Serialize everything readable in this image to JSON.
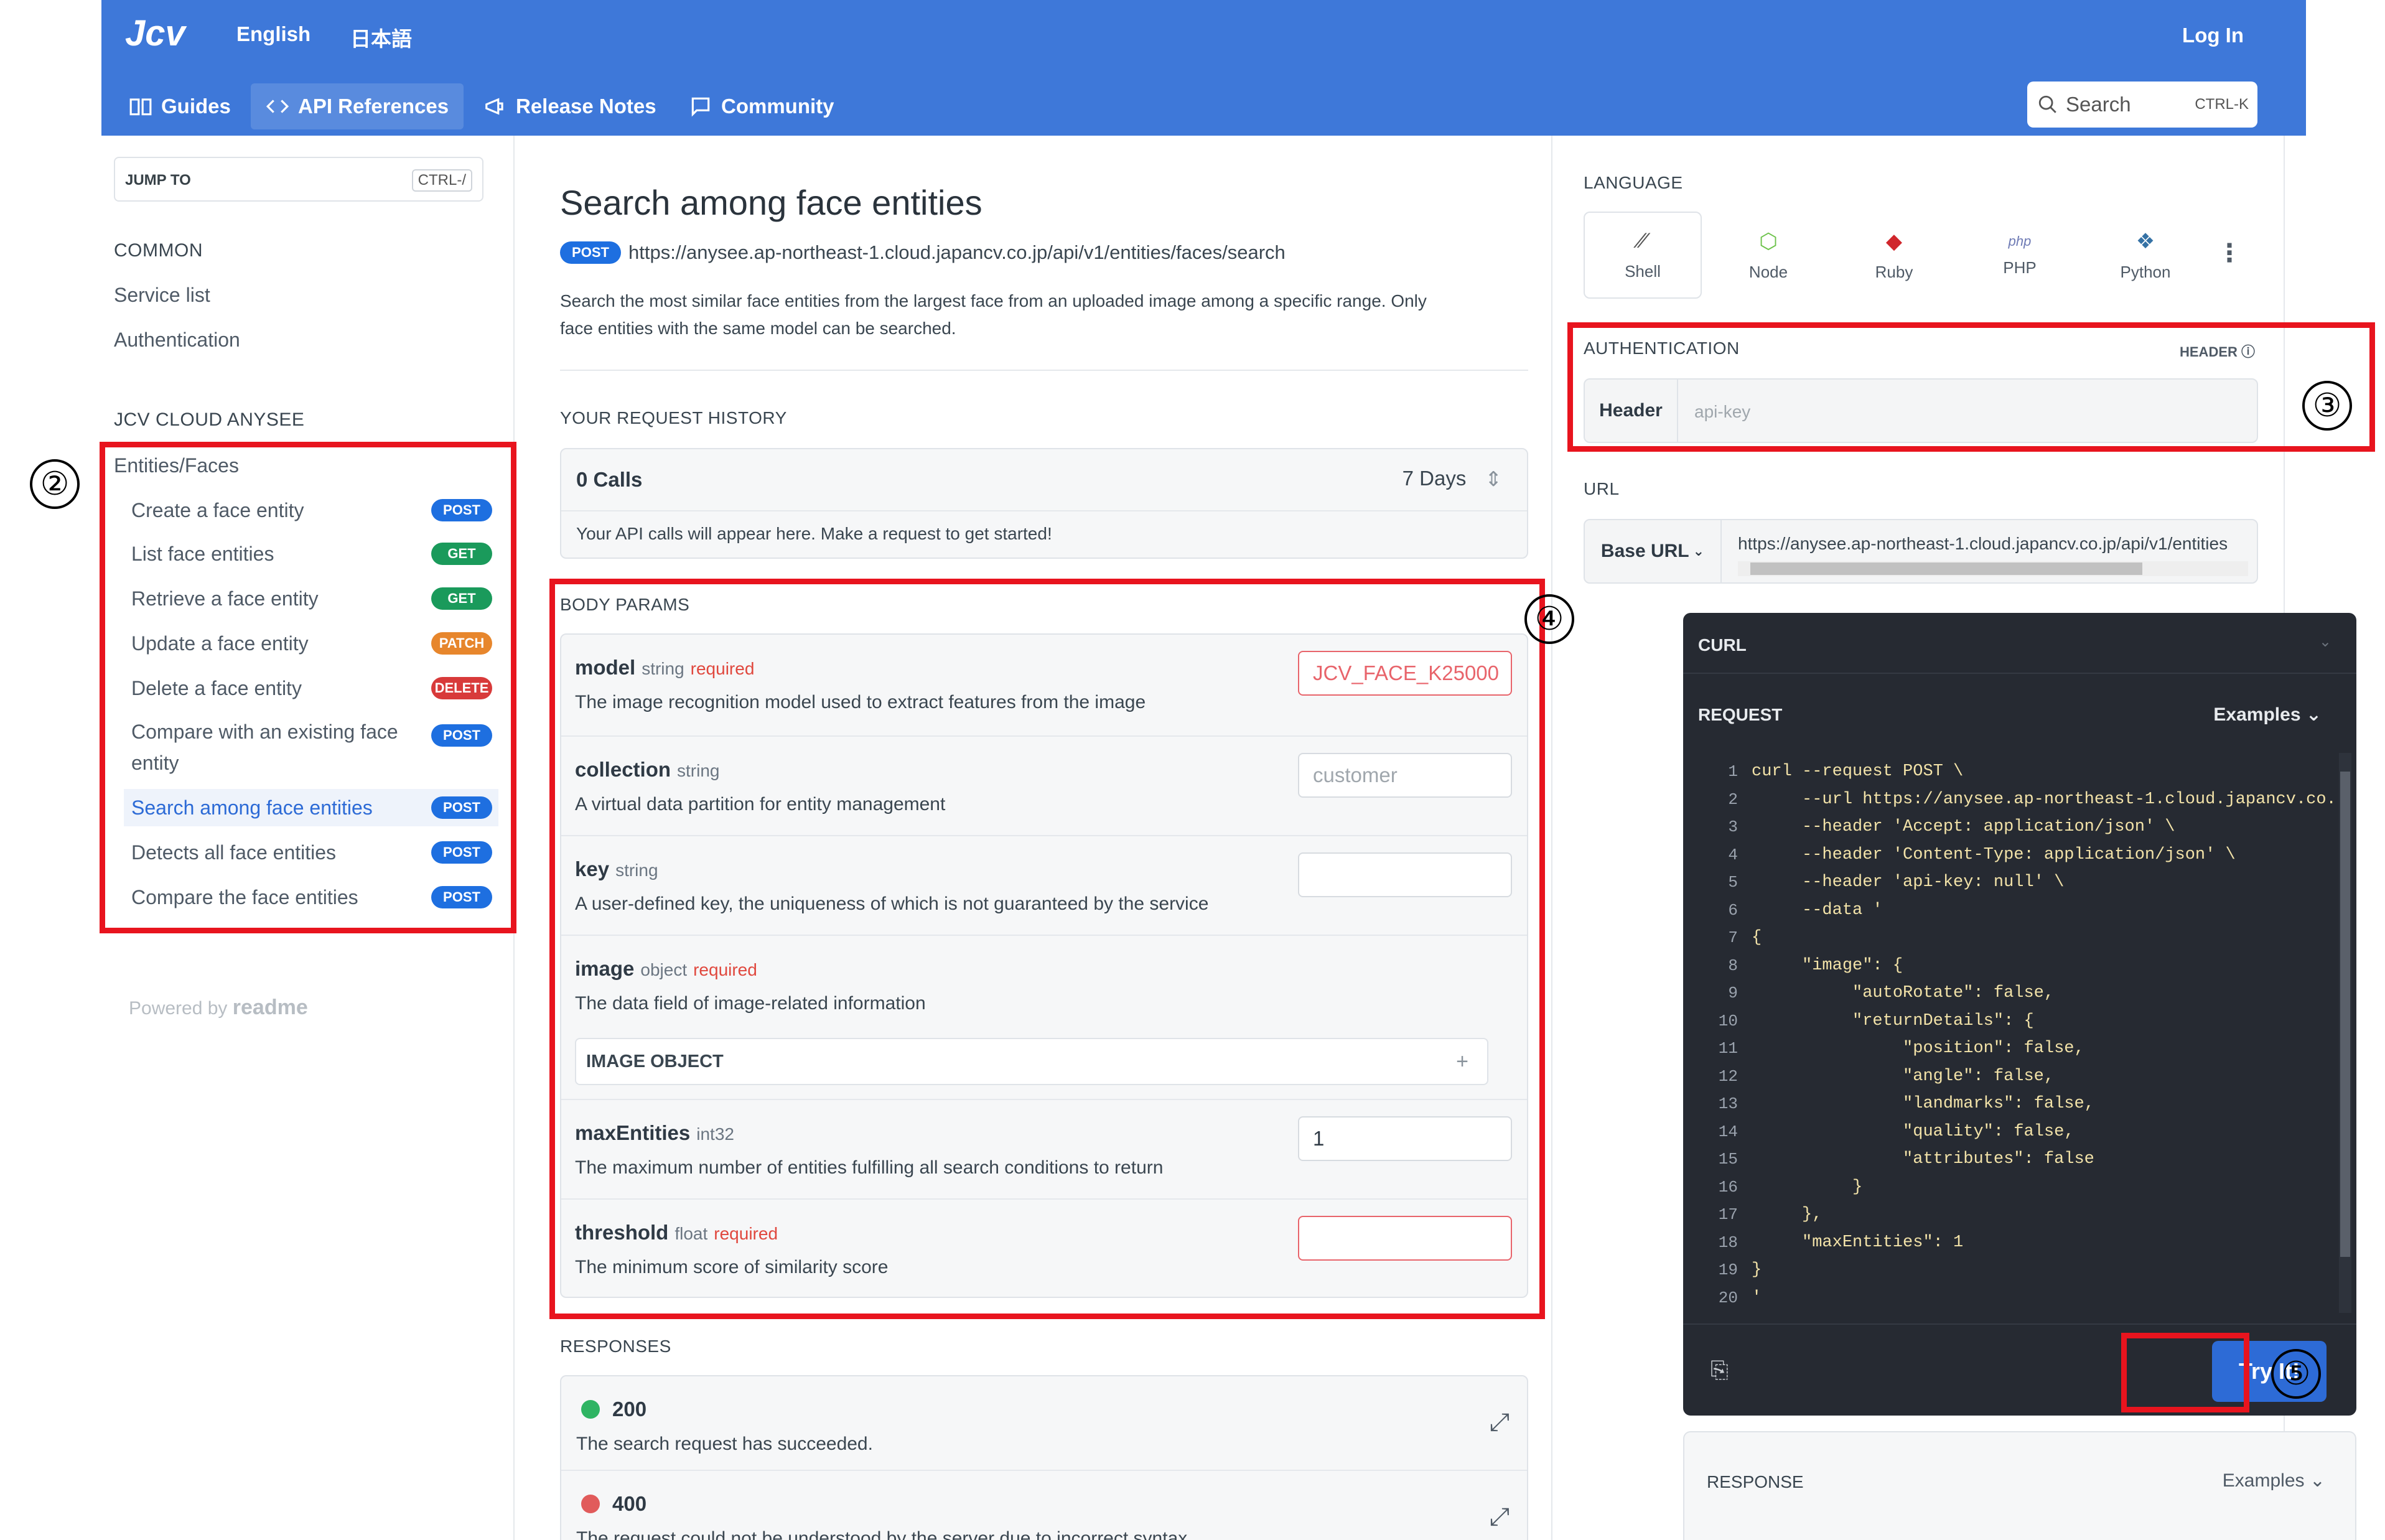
{
  "header": {
    "brand": "JCV",
    "lang_en": "English",
    "lang_ja": "日本語",
    "login": "Log In"
  },
  "nav": {
    "items": [
      {
        "label": "Guides",
        "icon": "book-icon"
      },
      {
        "label": "API References",
        "icon": "code-icon"
      },
      {
        "label": "Release Notes",
        "icon": "megaphone-icon"
      },
      {
        "label": "Community",
        "icon": "chat-icon"
      }
    ],
    "search_placeholder": "Search",
    "search_shortcut": "CTRL-K"
  },
  "sidebar": {
    "jump_label": "JUMP TO",
    "jump_shortcut": "CTRL-/",
    "common_heading": "COMMON",
    "common_items": [
      "Service list",
      "Authentication"
    ],
    "section_heading": "JCV CLOUD ANYSEE",
    "group_label": "Entities/Faces",
    "items": [
      {
        "label": "Create a face entity",
        "method": "POST"
      },
      {
        "label": "List face entities",
        "method": "GET"
      },
      {
        "label": "Retrieve a face entity",
        "method": "GET"
      },
      {
        "label": "Update a face entity",
        "method": "PATCH"
      },
      {
        "label": "Delete a face entity",
        "method": "DELETE"
      },
      {
        "label": "Compare with an existing face entity",
        "method": "POST"
      },
      {
        "label": "Search among face entities",
        "method": "POST"
      },
      {
        "label": "Detects all face entities",
        "method": "POST"
      },
      {
        "label": "Compare the face entities",
        "method": "POST"
      }
    ],
    "powered": "Powered by",
    "powered_brand": "readme"
  },
  "main": {
    "title": "Search among face entities",
    "method": "POST",
    "url": "https://anysee.ap-northeast-1.cloud.japancv.co.jp/api/v1/entities/faces/search",
    "description_1": "Search the most similar face entities from the largest face from an uploaded image among a specific range. Only",
    "description_2": "face entities with the same model can be searched.",
    "history_heading": "YOUR REQUEST HISTORY",
    "calls": "0 Calls",
    "days": "7 Days",
    "history_empty": "Your API calls will appear here. Make a request to get started!",
    "body_heading": "BODY PARAMS",
    "params": [
      {
        "name": "model",
        "type": "string",
        "required": "required",
        "desc": "The image recognition model used to extract features from the image",
        "value": "JCV_FACE_K25000"
      },
      {
        "name": "collection",
        "type": "string",
        "required": "",
        "desc": "A virtual data partition for entity management",
        "value": "customer"
      },
      {
        "name": "key",
        "type": "string",
        "required": "",
        "desc": "A user-defined key, the uniqueness of which is not guaranteed by the service",
        "value": ""
      },
      {
        "name": "image",
        "type": "object",
        "required": "required",
        "desc": "The data field of image-related information",
        "value": ""
      },
      {
        "name": "maxEntities",
        "type": "int32",
        "required": "",
        "desc": "The maximum number of entities fulfilling all search conditions to return",
        "value": "1"
      },
      {
        "name": "threshold",
        "type": "float",
        "required": "required",
        "desc": "The minimum score of similarity score",
        "value": ""
      }
    ],
    "image_object": "IMAGE OBJECT",
    "plus": "+",
    "responses_heading": "RESPONSES",
    "responses": [
      {
        "code": "200",
        "desc": "The search request has succeeded.",
        "color": "#2fb463"
      },
      {
        "code": "400",
        "desc": "The request could not be understood by the server due to incorrect syntax.",
        "color": "#e15b5b"
      }
    ]
  },
  "right": {
    "language_heading": "LANGUAGE",
    "languages": [
      "Shell",
      "Node",
      "Ruby",
      "PHP",
      "Python"
    ],
    "more": "⋮",
    "auth_heading": "AUTHENTICATION",
    "auth_type": "HEADER",
    "auth_label": "Header",
    "auth_placeholder": "api-key",
    "url_heading": "URL",
    "base_url_label": "Base URL",
    "base_url": "https://anysee.ap-northeast-1.cloud.japancv.co.jp/api/v1/entities",
    "curl_heading": "CURL",
    "request_heading": "REQUEST",
    "examples": "Examples",
    "code_lines": [
      "curl --request POST \\",
      "     --url https://anysee.ap-northeast-1.cloud.japancv.co.",
      "     --header 'Accept: application/json' \\",
      "     --header 'Content-Type: application/json' \\",
      "     --header 'api-key: null' \\",
      "     --data '",
      "{",
      "     \"image\": {",
      "          \"autoRotate\": false,",
      "          \"returnDetails\": {",
      "               \"position\": false,",
      "               \"angle\": false,",
      "               \"landmarks\": false,",
      "               \"quality\": false,",
      "               \"attributes\": false",
      "          }",
      "     },",
      "     \"maxEntities\": 1",
      "}",
      "'"
    ],
    "try_it": "Try It!",
    "response_heading": "RESPONSE"
  },
  "callouts": [
    "②",
    "③",
    "④",
    "⑤"
  ]
}
